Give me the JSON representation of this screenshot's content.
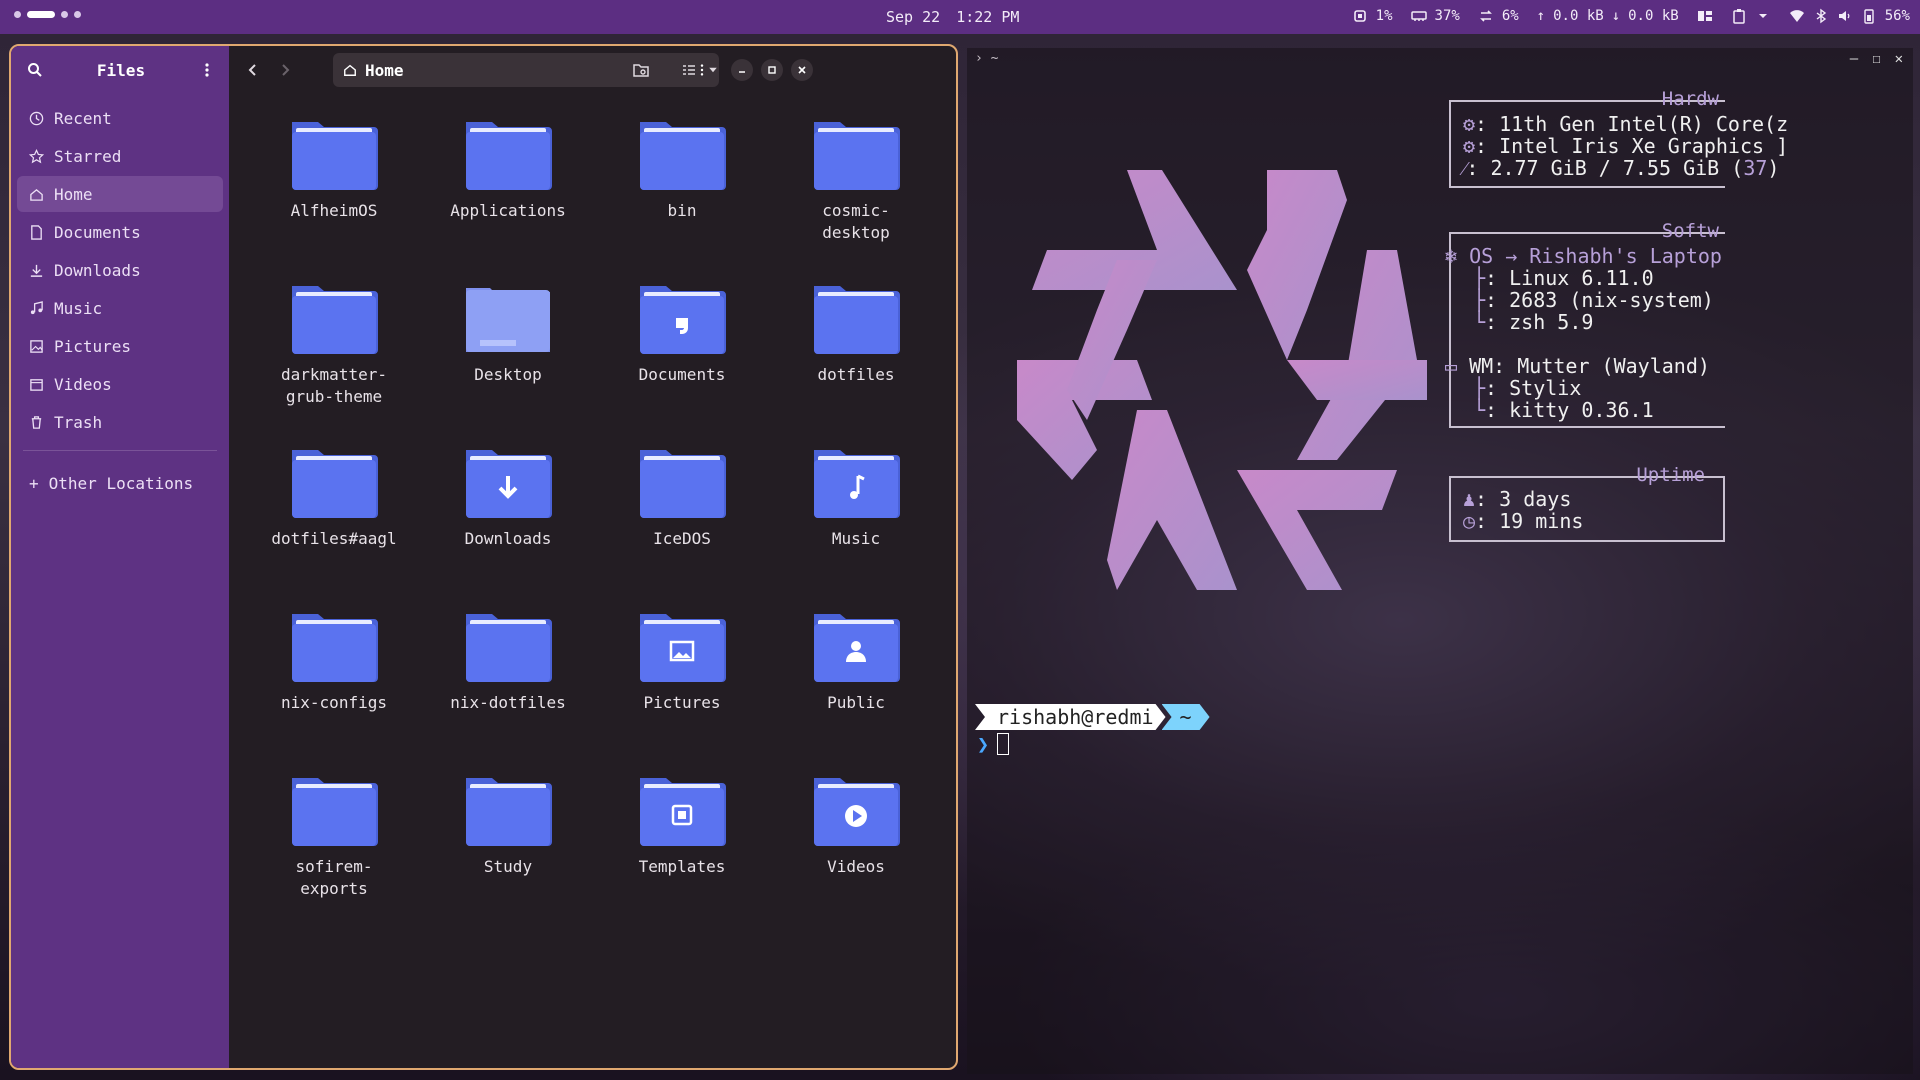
{
  "topbar": {
    "date": "Sep 22",
    "time": "1:22 PM",
    "cpu": "1%",
    "memory": "37%",
    "swap": "6%",
    "net_up": "0.0 kB",
    "net_down": "0.0 kB",
    "battery": "56%"
  },
  "files": {
    "title": "Files",
    "path": "Home",
    "sidebar": [
      {
        "label": "Recent",
        "icon": "clock-icon"
      },
      {
        "label": "Starred",
        "icon": "star-icon"
      },
      {
        "label": "Home",
        "icon": "home-icon",
        "active": true
      },
      {
        "label": "Documents",
        "icon": "document-icon"
      },
      {
        "label": "Downloads",
        "icon": "download-icon"
      },
      {
        "label": "Music",
        "icon": "music-icon"
      },
      {
        "label": "Pictures",
        "icon": "picture-icon"
      },
      {
        "label": "Videos",
        "icon": "video-icon"
      },
      {
        "label": "Trash",
        "icon": "trash-icon"
      }
    ],
    "other_locations": "Other Locations",
    "items": [
      {
        "name": "AlfheimOS",
        "type": "folder"
      },
      {
        "name": "Applications",
        "type": "folder"
      },
      {
        "name": "bin",
        "type": "folder"
      },
      {
        "name": "cosmic-\ndesktop",
        "type": "folder"
      },
      {
        "name": "darkmatter-\ngrub-theme",
        "type": "folder"
      },
      {
        "name": "Desktop",
        "type": "desktop"
      },
      {
        "name": "Documents",
        "type": "documents"
      },
      {
        "name": "dotfiles",
        "type": "folder"
      },
      {
        "name": "dotfiles#aagl",
        "type": "folder"
      },
      {
        "name": "Downloads",
        "type": "downloads"
      },
      {
        "name": "IceDOS",
        "type": "folder"
      },
      {
        "name": "Music",
        "type": "music"
      },
      {
        "name": "nix-configs",
        "type": "folder"
      },
      {
        "name": "nix-dotfiles",
        "type": "folder"
      },
      {
        "name": "Pictures",
        "type": "pictures"
      },
      {
        "name": "Public",
        "type": "public"
      },
      {
        "name": "sofirem-\nexports",
        "type": "folder"
      },
      {
        "name": "Study",
        "type": "folder"
      },
      {
        "name": "Templates",
        "type": "templates"
      },
      {
        "name": "Videos",
        "type": "videos"
      }
    ]
  },
  "terminal": {
    "title": "~",
    "hardware_title": "Hardw",
    "hardware": [
      {
        "key": "",
        "value": "11th Gen Intel(R) Core(z"
      },
      {
        "key": "",
        "value": "Intel Iris Xe Graphics ]"
      },
      {
        "key": "",
        "value": "2.77 GiB / 7.55 GiB (",
        "extra": "37",
        "tail": ")"
      }
    ],
    "software_title": "Softw",
    "os_line": "OS → Rishabh's Laptop",
    "software": [
      "Linux 6.11.0",
      "2683 (nix-system)",
      "zsh 5.9"
    ],
    "wm_line": "WM: Mutter (Wayland)",
    "wm": [
      "Stylix",
      "kitty 0.36.1"
    ],
    "uptime_title": "Uptime",
    "uptime": [
      "3 days",
      "19 mins"
    ],
    "prompt_user": "rishabh@redmi",
    "prompt_dir": "~",
    "prompt_char": "❯"
  }
}
